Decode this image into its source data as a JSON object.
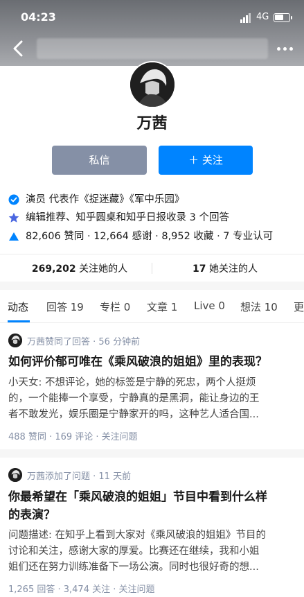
{
  "status_bar": {
    "time": "04:23",
    "network": "4G"
  },
  "profile": {
    "name": "万茜",
    "message_button": "私信",
    "follow_button": "＋ 关注",
    "info": [
      {
        "icon": "verified-icon",
        "text": "演员 代表作《捉迷藏》《军中乐园》"
      },
      {
        "icon": "star-icon",
        "text": "编辑推荐、知乎圆桌和知乎日报收录 3 个回答"
      },
      {
        "icon": "triangle-up-icon",
        "text": "82,606 赞同 · 12,664 感谢 · 8,952 收藏 · 7 专业认可"
      }
    ],
    "followers_count": "269,202",
    "followers_label": "关注她的人",
    "following_count": "17",
    "following_label": "她关注的人"
  },
  "tabs": [
    "动态",
    "回答 19",
    "专栏 0",
    "文章 1",
    "Live 0",
    "想法 10",
    "更"
  ],
  "feed": [
    {
      "meta": "万茜赞同了回答 · 56 分钟前",
      "title": "如何评价郁可唯在《乘风破浪的姐姐》里的表现？",
      "excerpt_lines": [
        "小天女: 不想评论，她的标签是宁静的死忠，两个人挺烦",
        "的，一个能捧一个享受，宁静真的是黑洞，能让身边的王",
        "者不敢发光，娱乐圈是宁静家开的吗，这种艺人适合国..."
      ],
      "footer": "488 赞同 · 169 评论 · 关注问题"
    },
    {
      "meta": "万茜添加了问题 · 11 天前",
      "title_lines": [
        "你最希望在「乘风破浪的姐姐」节目中看到什么样",
        "的表演？"
      ],
      "excerpt_lines": [
        "问题描述: 在知乎上看到大家对《乘风破浪的姐姐》节目的",
        "讨论和关注，感谢大家的厚爱。比赛还在继续，我和小姐",
        "姐们还在努力训练准备下一场公演。同时也很好奇的想..."
      ],
      "footer": "1,265 回答 · 3,474 关注 · 关注问题"
    }
  ],
  "colors": {
    "accent": "#0084ff",
    "message_button": "#8590a6",
    "muted": "#8590a6"
  }
}
